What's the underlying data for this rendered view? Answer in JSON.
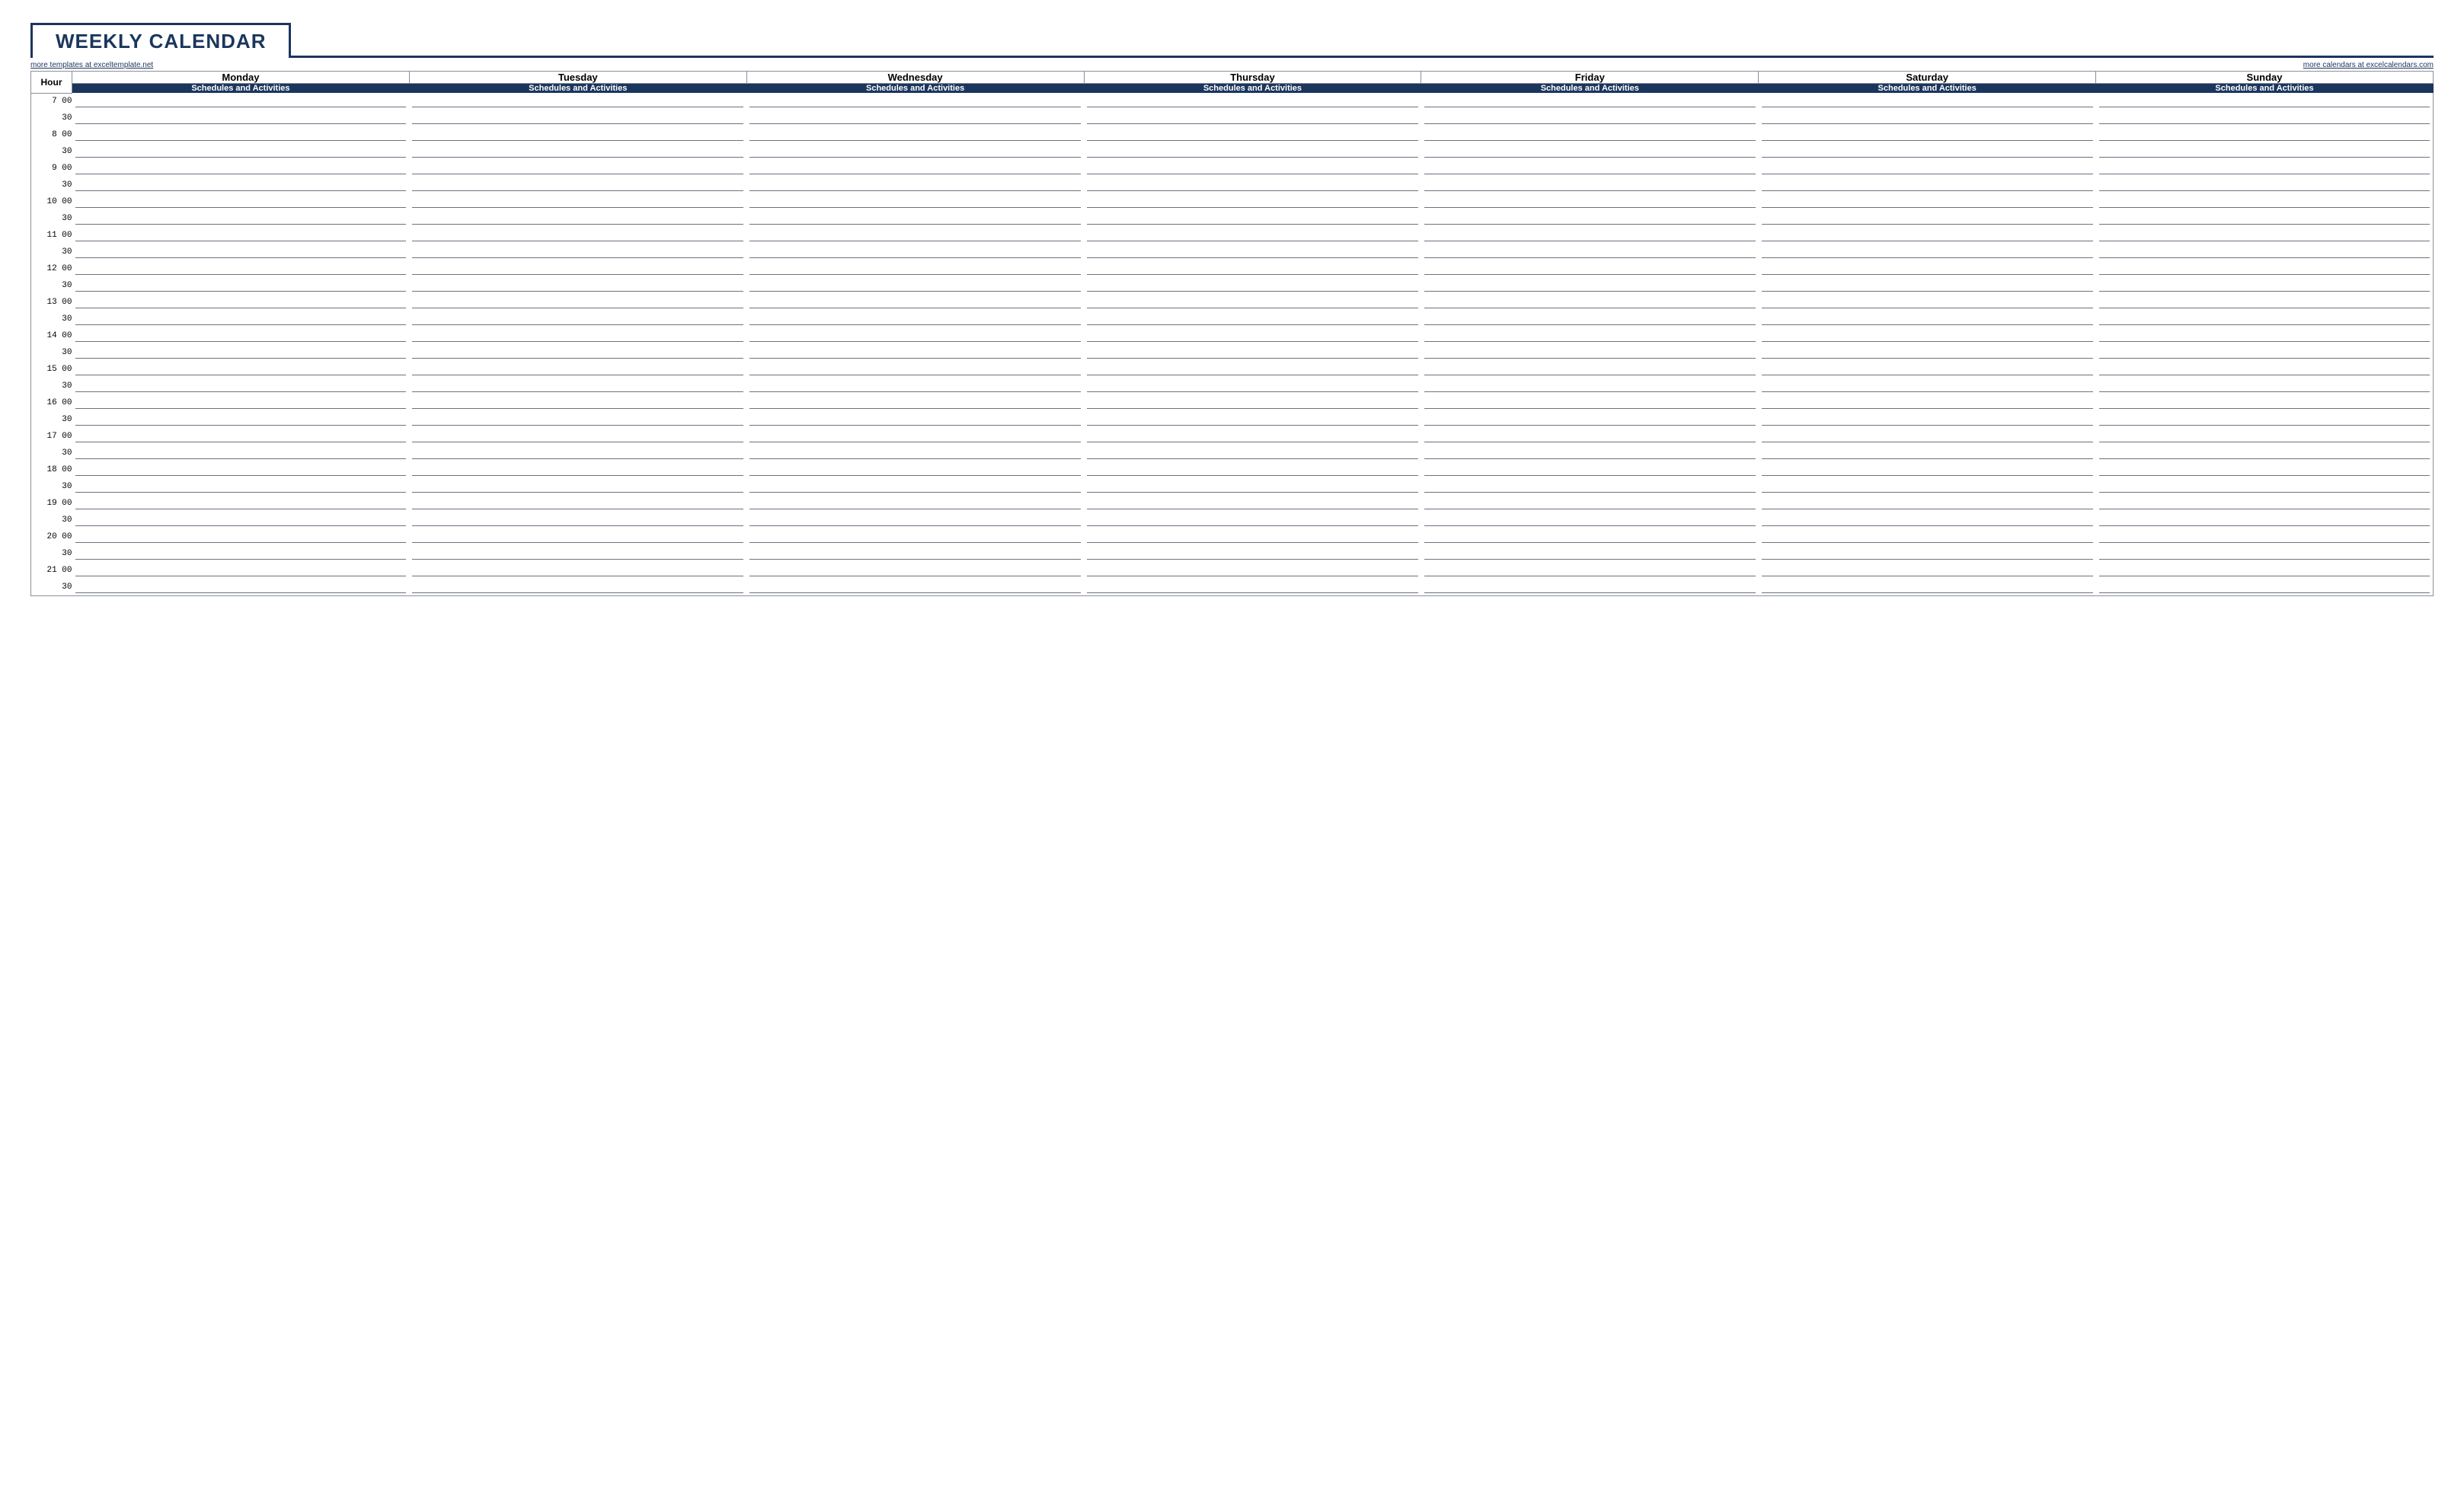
{
  "title": "WEEKLY CALENDAR",
  "links": {
    "left": "more templates at exceltemplate.net",
    "right": "more calendars at excelcalendars.com"
  },
  "headers": {
    "hour": "Hour",
    "days": [
      "Monday",
      "Tuesday",
      "Wednesday",
      "Thursday",
      "Friday",
      "Saturday",
      "Sunday"
    ],
    "sub": "Schedules and Activities"
  },
  "timeslots": [
    {
      "h": "7",
      "m": "00"
    },
    {
      "h": "",
      "m": "30"
    },
    {
      "h": "8",
      "m": "00"
    },
    {
      "h": "",
      "m": "30"
    },
    {
      "h": "9",
      "m": "00"
    },
    {
      "h": "",
      "m": "30"
    },
    {
      "h": "10",
      "m": "00"
    },
    {
      "h": "",
      "m": "30"
    },
    {
      "h": "11",
      "m": "00"
    },
    {
      "h": "",
      "m": "30"
    },
    {
      "h": "12",
      "m": "00"
    },
    {
      "h": "",
      "m": "30"
    },
    {
      "h": "13",
      "m": "00"
    },
    {
      "h": "",
      "m": "30"
    },
    {
      "h": "14",
      "m": "00"
    },
    {
      "h": "",
      "m": "30"
    },
    {
      "h": "15",
      "m": "00"
    },
    {
      "h": "",
      "m": "30"
    },
    {
      "h": "16",
      "m": "00"
    },
    {
      "h": "",
      "m": "30"
    },
    {
      "h": "17",
      "m": "00"
    },
    {
      "h": "",
      "m": "30"
    },
    {
      "h": "18",
      "m": "00"
    },
    {
      "h": "",
      "m": "30"
    },
    {
      "h": "19",
      "m": "00"
    },
    {
      "h": "",
      "m": "30"
    },
    {
      "h": "20",
      "m": "00"
    },
    {
      "h": "",
      "m": "30"
    },
    {
      "h": "21",
      "m": "00"
    },
    {
      "h": "",
      "m": "30"
    }
  ]
}
